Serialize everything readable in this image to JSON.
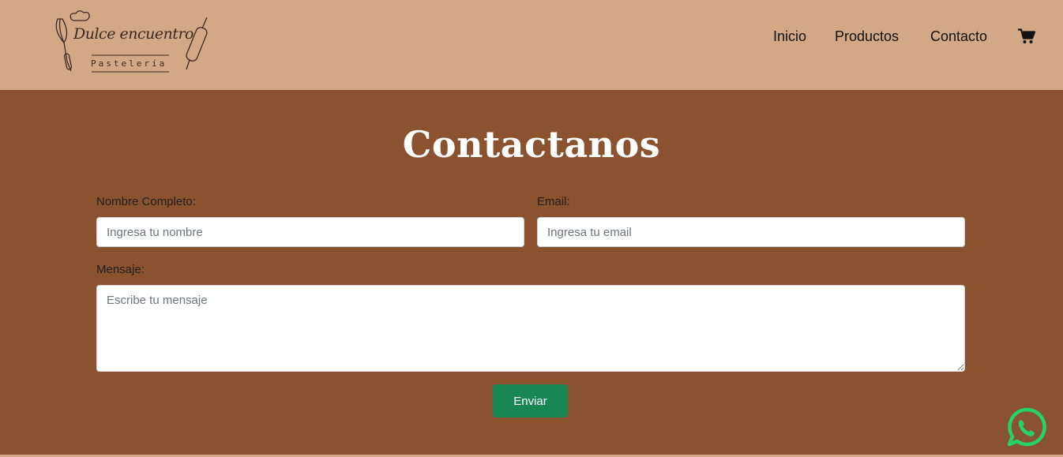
{
  "brand": {
    "name": "Dulce encuentro",
    "tagline": "Pastelería"
  },
  "nav": {
    "items": [
      "Inicio",
      "Productos",
      "Contacto"
    ],
    "cart_icon": "shopping-cart-icon"
  },
  "contact": {
    "title": "Contactanos",
    "name_label": "Nombre Completo:",
    "name_placeholder": "Ingresa tu nombre",
    "email_label": "Email:",
    "email_placeholder": "Ingresa tu email",
    "message_label": "Mensaje:",
    "message_placeholder": "Escribe tu mensaje",
    "submit_label": "Enviar"
  },
  "floating": {
    "whatsapp_icon": "whatsapp-icon"
  },
  "colors": {
    "header_bg": "#d2a886",
    "main_bg": "#8b5230",
    "button_green": "#198754",
    "whatsapp_green": "#25d366"
  }
}
